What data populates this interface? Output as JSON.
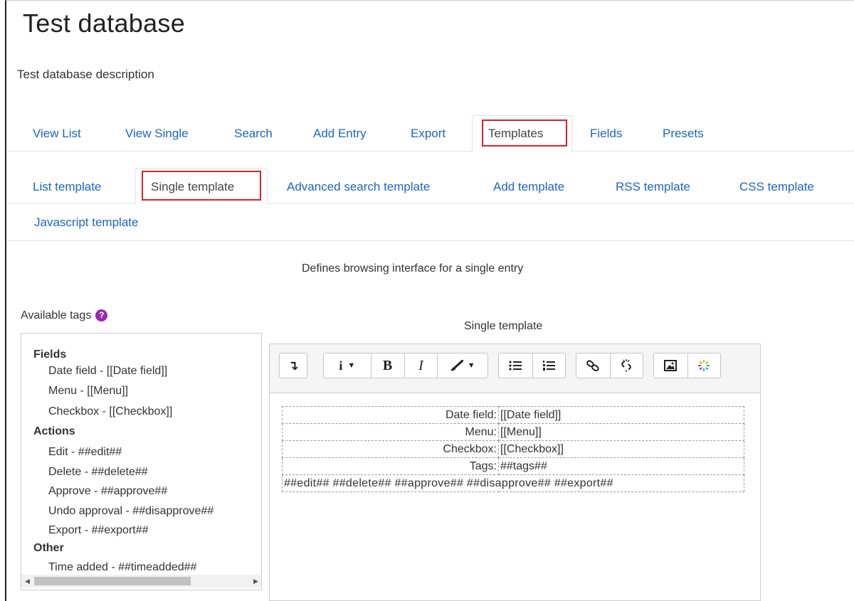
{
  "page": {
    "title": "Test database",
    "description": "Test database description"
  },
  "primary_tabs": [
    {
      "label": "View List",
      "active": false
    },
    {
      "label": "View Single",
      "active": false
    },
    {
      "label": "Search",
      "active": false
    },
    {
      "label": "Add Entry",
      "active": false
    },
    {
      "label": "Export",
      "active": false
    },
    {
      "label": "Templates",
      "active": true
    },
    {
      "label": "Fields",
      "active": false
    },
    {
      "label": "Presets",
      "active": false
    }
  ],
  "secondary_tabs": [
    {
      "label": "List template",
      "active": false
    },
    {
      "label": "Single template",
      "active": true
    },
    {
      "label": "Advanced search template",
      "active": false
    },
    {
      "label": "Add template",
      "active": false
    },
    {
      "label": "RSS template",
      "active": false
    },
    {
      "label": "CSS template",
      "active": false
    },
    {
      "label": "Javascript template",
      "active": false
    }
  ],
  "template_description": "Defines browsing interface for a single entry",
  "available_tags": {
    "label": "Available tags",
    "help_icon": "question-circle-icon",
    "groups": [
      {
        "name": "Fields",
        "items": [
          "Date field - [[Date field]]",
          "Menu - [[Menu]]",
          "Checkbox - [[Checkbox]]"
        ]
      },
      {
        "name": "Actions",
        "items": [
          "Edit - ##edit##",
          "Delete - ##delete##",
          "Approve - ##approve##",
          "Undo approval - ##disapprove##",
          "Export - ##export##"
        ]
      },
      {
        "name": "Other",
        "items": [
          "Time added - ##timeadded##"
        ]
      }
    ]
  },
  "editor": {
    "caption": "Single template",
    "toolbar_icons": [
      "toggle-toolbar-icon",
      "paragraph-style-icon",
      "bold-icon",
      "italic-icon",
      "font-color-icon",
      "bullet-list-icon",
      "numbered-list-icon",
      "link-icon",
      "unlink-icon",
      "image-icon",
      "media-icon"
    ],
    "toolbar_glyphs": {
      "bold": "B",
      "italic": "I",
      "info": "i"
    },
    "rows": [
      {
        "label": "Date field:",
        "value": "[[Date field]]"
      },
      {
        "label": "Menu:",
        "value": "[[Menu]]"
      },
      {
        "label": "Checkbox:",
        "value": "[[Checkbox]]"
      },
      {
        "label": "Tags:",
        "value": "##tags##"
      }
    ],
    "actions_row": "##edit## ##delete## ##approve## ##disapprove## ##export##"
  },
  "colors": {
    "link": "#1a66c4",
    "highlight": "#e0202a",
    "help": "#9c27b0"
  }
}
